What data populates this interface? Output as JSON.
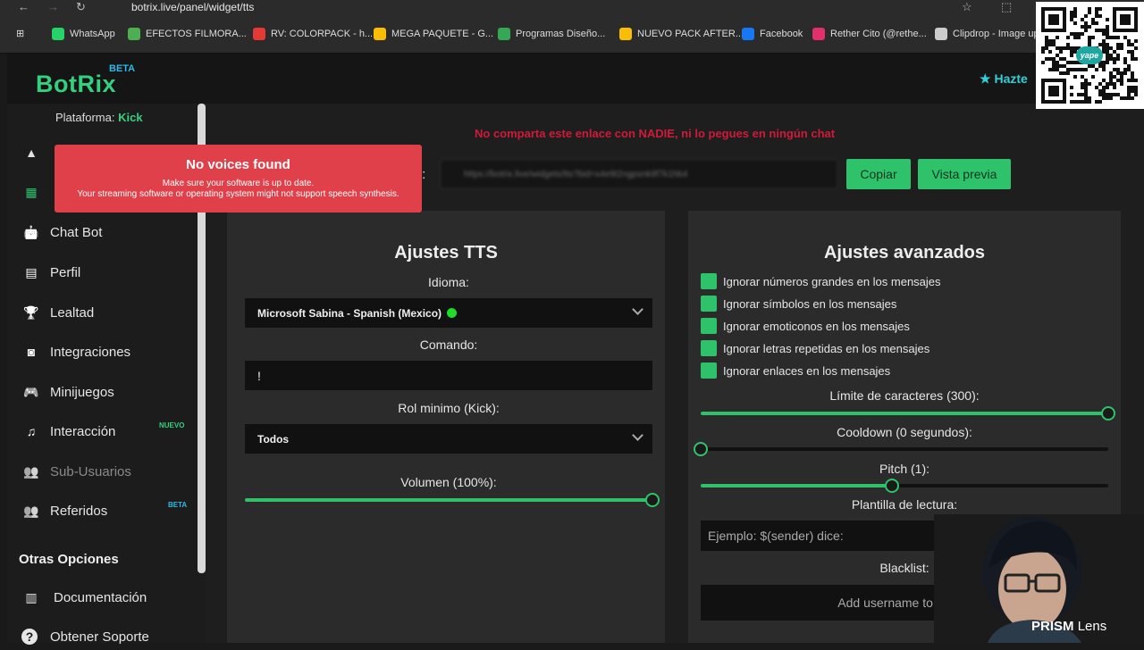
{
  "browser": {
    "url": "botrix.live/panel/widget/tts",
    "bookmarks": [
      {
        "label": "WhatsApp",
        "color": "#25d366"
      },
      {
        "label": "EFECTOS FILMORA...",
        "color": "#4caf50"
      },
      {
        "label": "RV: COLORPACK - h...",
        "color": "#e53935"
      },
      {
        "label": "MEGA PAQUETE - G...",
        "color": "#fbbc05"
      },
      {
        "label": "Programas Diseño...",
        "color": "#34a853"
      },
      {
        "label": "NUEVO PACK AFTER...",
        "color": "#fbbc05"
      },
      {
        "label": "Facebook",
        "color": "#1877f2"
      },
      {
        "label": "Rether Cito (@rethe...",
        "color": "#e1306c"
      },
      {
        "label": "Clipdrop - Image up",
        "color": "#cccccc"
      }
    ]
  },
  "app": {
    "logo": "BotRix",
    "logo_badge": "BETA",
    "header_cta": "Hazte"
  },
  "sidebar": {
    "platform_label": "Plataforma:",
    "platform_value": "Kick",
    "items": [
      {
        "label": "Chat Bot",
        "icon": "robot-icon"
      },
      {
        "label": "Perfil",
        "icon": "id-card-icon"
      },
      {
        "label": "Lealtad",
        "icon": "trophy-icon"
      },
      {
        "label": "Integraciones",
        "icon": "discord-icon"
      },
      {
        "label": "Minijuegos",
        "icon": "gamepad-icon"
      },
      {
        "label": "Interacción",
        "icon": "music-icon",
        "badge": "NUEVO"
      },
      {
        "label": "Sub-Usuarios",
        "icon": "users-icon"
      },
      {
        "label": "Referidos",
        "icon": "user-group-icon",
        "badge": "BETA"
      }
    ],
    "section_title": "Otras Opciones",
    "other_items": [
      {
        "label": "Documentación",
        "icon": "docs-icon"
      },
      {
        "label": "Obtener Soporte",
        "icon": "help-icon"
      }
    ]
  },
  "main": {
    "warning": "No comparta este enlace con NADIE, ni lo pegues en ningún chat",
    "url_label": "t:",
    "url_value": "https://botrix.live/widgets/tts?bid=x4e9t2ngpsnk9f7k1hb4",
    "copy_button": "Copiar",
    "preview_button": "Vista previa"
  },
  "tts": {
    "title": "Ajustes TTS",
    "idioma_label": "Idioma:",
    "idioma_value": "Microsoft Sabina - Spanish (Mexico)",
    "comando_label": "Comando:",
    "comando_value": "!",
    "rol_label": "Rol minimo (Kick):",
    "rol_value": "Todos",
    "volumen_label": "Volumen (100%):",
    "volumen_fraction": 1.0
  },
  "advanced": {
    "title": "Ajustes avanzados",
    "checks": [
      "Ignorar números grandes en los mensajes",
      "Ignorar símbolos en los mensajes",
      "Ignorar emoticonos en los mensajes",
      "Ignorar letras repetidas en los mensajes",
      "Ignorar enlaces en los mensajes"
    ],
    "limite_label": "Límite de caracteres (300):",
    "limite_fraction": 1.0,
    "cooldown_label": "Cooldown (0 segundos):",
    "cooldown_fraction": 0.0,
    "pitch_label": "Pitch (1):",
    "pitch_fraction": 0.47,
    "plantilla_label": "Plantilla de lectura:",
    "plantilla_placeholder": "Ejemplo: $(sender) dice:",
    "blacklist_label": "Blacklist:",
    "blacklist_placeholder": "Add username to blackli"
  },
  "toast": {
    "title": "No voices found",
    "line1": "Make sure your software is up to date.",
    "line2": "Your streaming software or operating system might not support speech synthesis."
  },
  "overlay": {
    "brand_bold": "PRISM",
    "brand_rest": "Lens",
    "qr_label": "yape"
  },
  "colors": {
    "accent": "#2ec36b",
    "warning": "#d01a3a",
    "toast": "#e0404a"
  }
}
